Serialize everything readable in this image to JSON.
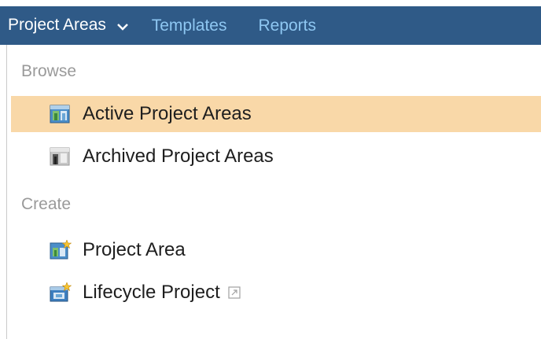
{
  "nav": {
    "project_areas": "Project Areas",
    "templates": "Templates",
    "reports": "Reports"
  },
  "menu": {
    "browse_label": "Browse",
    "create_label": "Create",
    "browse_items": [
      {
        "label": "Active Project Areas",
        "icon": "project-area-icon",
        "highlighted": true
      },
      {
        "label": "Archived Project Areas",
        "icon": "archived-project-area-icon",
        "highlighted": false
      }
    ],
    "create_items": [
      {
        "label": "Project Area",
        "icon": "new-project-area-icon"
      },
      {
        "label": "Lifecycle Project",
        "icon": "new-lifecycle-project-icon",
        "external": true
      }
    ]
  },
  "colors": {
    "navbar": "#2f5a87",
    "nav_link": "#8ec7f2",
    "highlight": "#f9d8a8",
    "section_label": "#9a9a9a"
  }
}
